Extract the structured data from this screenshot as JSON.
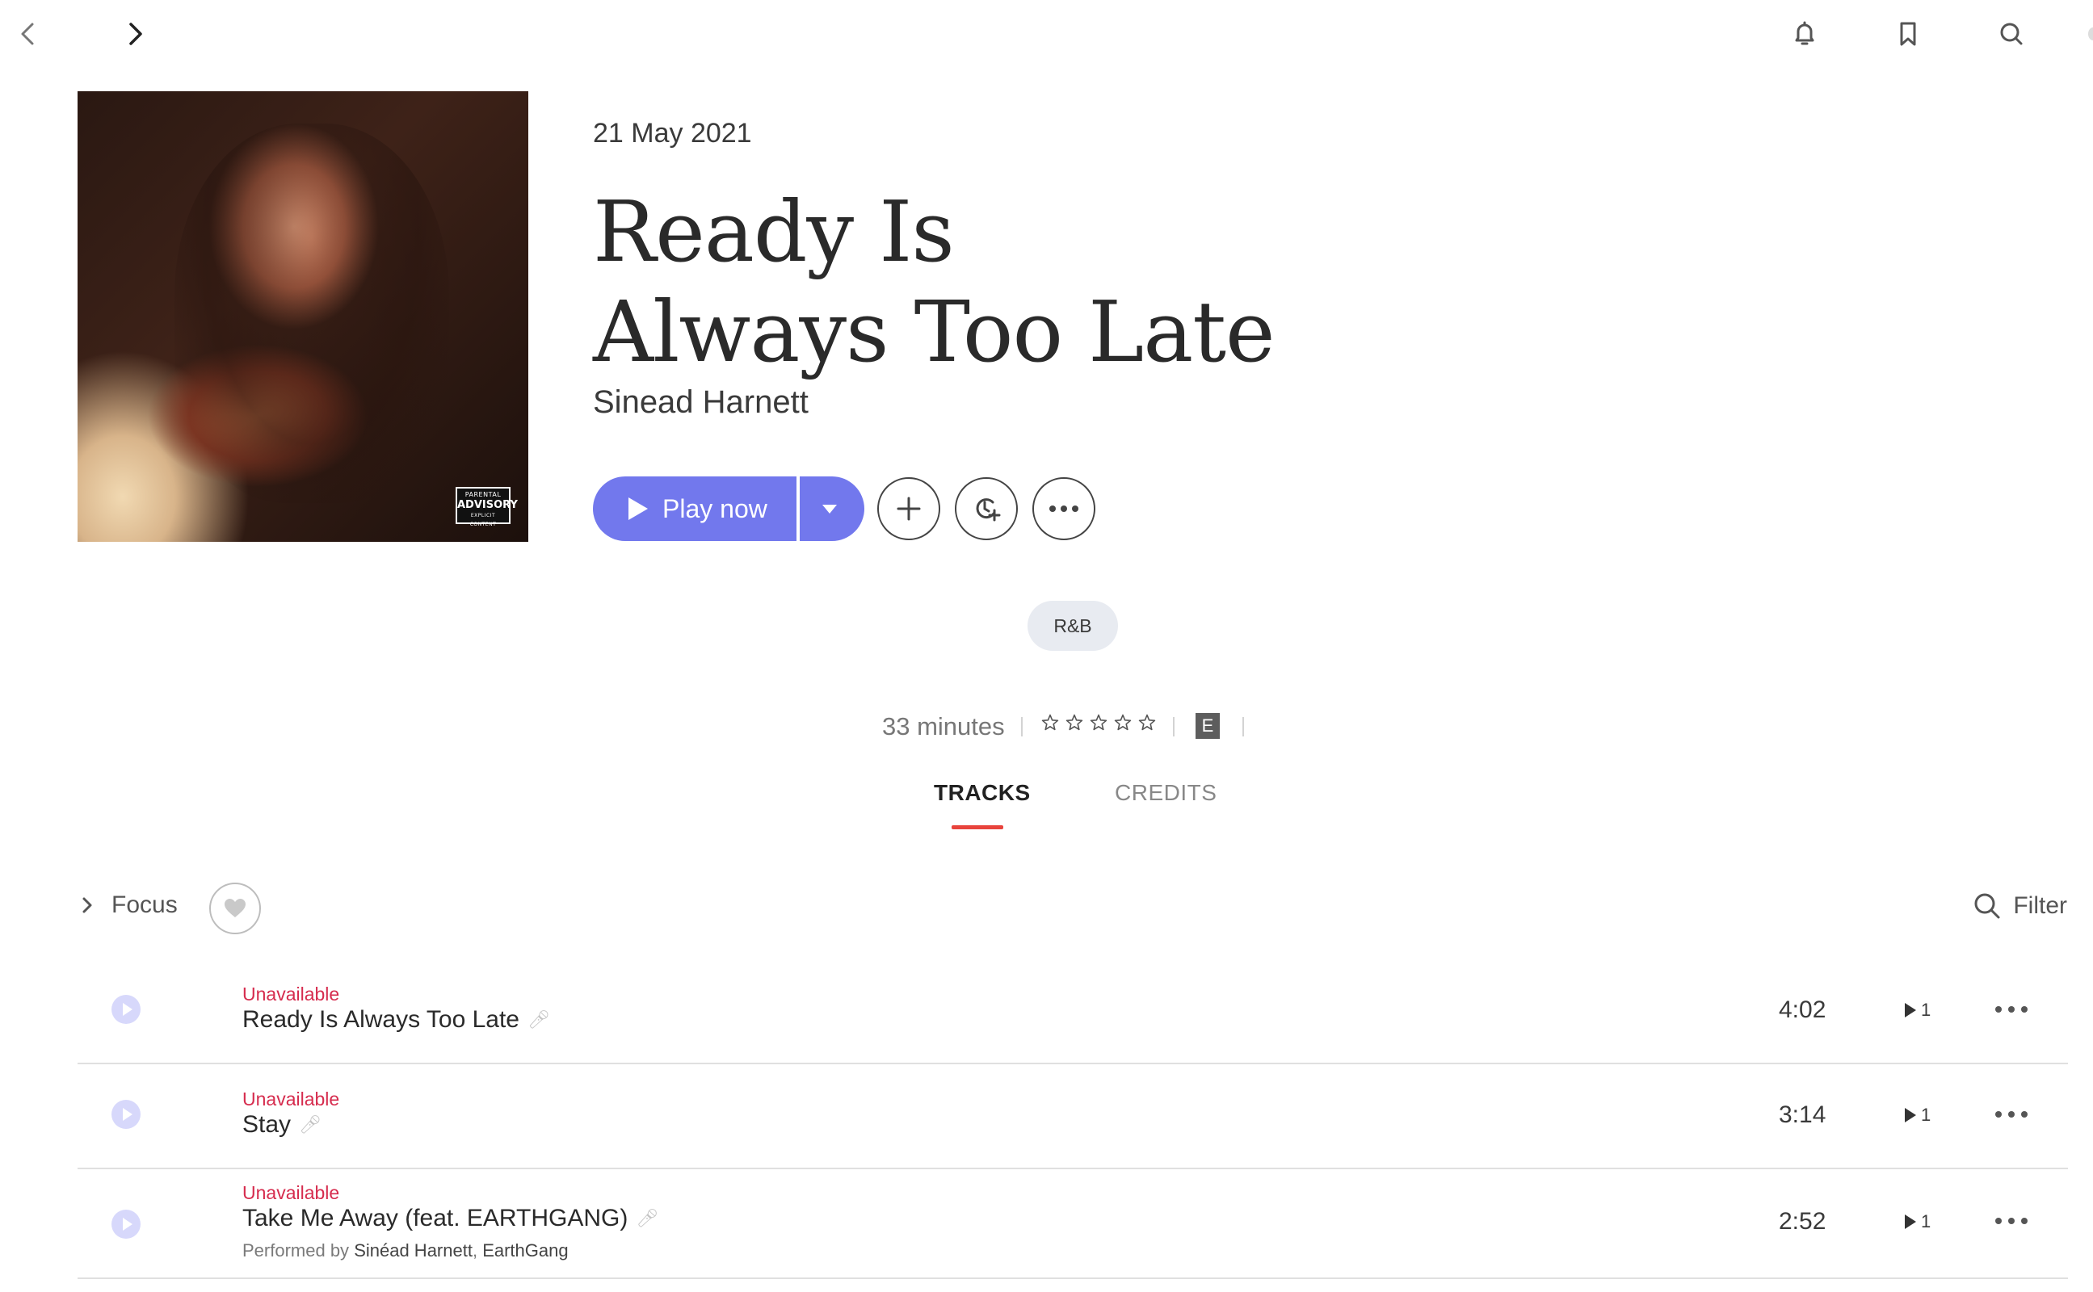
{
  "nav": {
    "back_icon": "chevron-left-icon",
    "forward_icon": "chevron-right-icon",
    "notifications_icon": "bell-icon",
    "bookmark_icon": "bookmark-icon",
    "search_icon": "search-icon"
  },
  "album": {
    "release_date": "21 May 2021",
    "title_line1": "Ready Is",
    "title_line2": "Always Too Late",
    "artist": "Sinead Harnett",
    "advisory_top": "PARENTAL",
    "advisory_mid": "ADVISORY",
    "advisory_bottom": "EXPLICIT CONTENT",
    "genre": "R&B",
    "duration": "33 minutes",
    "rating_stars": 0,
    "explicit_badge": "E"
  },
  "actions": {
    "play_label": "Play now",
    "add_icon": "plus-icon",
    "queue_icon": "clock-plus-icon",
    "more_icon": "more-dots-icon"
  },
  "tabs": [
    {
      "label": "TRACKS",
      "active": true
    },
    {
      "label": "CREDITS",
      "active": false
    }
  ],
  "toolbar": {
    "focus_label": "Focus",
    "filter_label": "Filter"
  },
  "tracks": [
    {
      "status": "Unavailable",
      "title": "Ready Is Always Too Late",
      "duration": "4:02",
      "plays": "1",
      "performed_by": null
    },
    {
      "status": "Unavailable",
      "title": "Stay",
      "duration": "3:14",
      "plays": "1",
      "performed_by": null
    },
    {
      "status": "Unavailable",
      "title": "Take Me Away (feat. EARTHGANG)",
      "duration": "2:52",
      "plays": "1",
      "performed_by": {
        "prefix": "Performed by",
        "artists": [
          "Sinéad Harnett",
          "EarthGang"
        ]
      }
    }
  ],
  "colors": {
    "accent": "#7278ed",
    "tab_underline": "#e8433c",
    "unavailable": "#d62c4e",
    "genre_bg": "#e8ebf1"
  }
}
